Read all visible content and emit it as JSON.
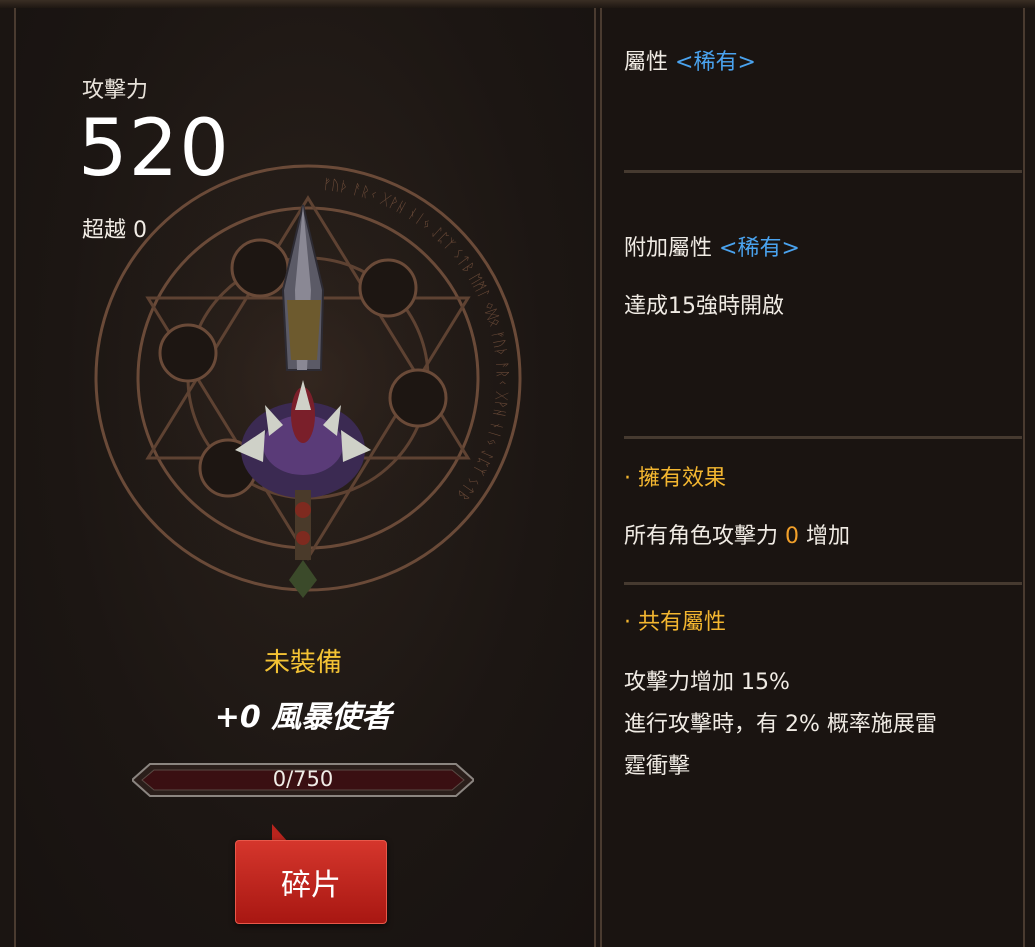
{
  "weapon": {
    "attack_label": "攻擊力",
    "attack_value": "520",
    "exceed_label": "超越 0",
    "equip_status": "未裝備",
    "name": "+0 風暴使者",
    "shard_progress_text": "0/750",
    "shard_progress_fraction": 0,
    "shard_button_label": "碎片"
  },
  "details": {
    "attribute_label": "屬性",
    "attribute_rarity": "<稀有>",
    "bonus_label": "附加屬性",
    "bonus_rarity": "<稀有>",
    "bonus_unlock_text": "達成15強時開啟",
    "owned_effect_title": "· 擁有效果",
    "owned_effect_prefix": "所有角色攻擊力",
    "owned_effect_value": "0",
    "owned_effect_suffix": "增加",
    "shared_title": "· 共有屬性",
    "shared_line1": "攻擊力增加 15%",
    "shared_line2": "進行攻擊時，有 2% 概率施展雷",
    "shared_line3": "霆衝擊"
  },
  "colors": {
    "gold": "#f3c234",
    "rare_blue": "#4aa3ef",
    "button_red": "#c4261d"
  },
  "icons": {
    "weapon": "storm-sword-icon",
    "magic_circle": "magic-circle-icon"
  }
}
